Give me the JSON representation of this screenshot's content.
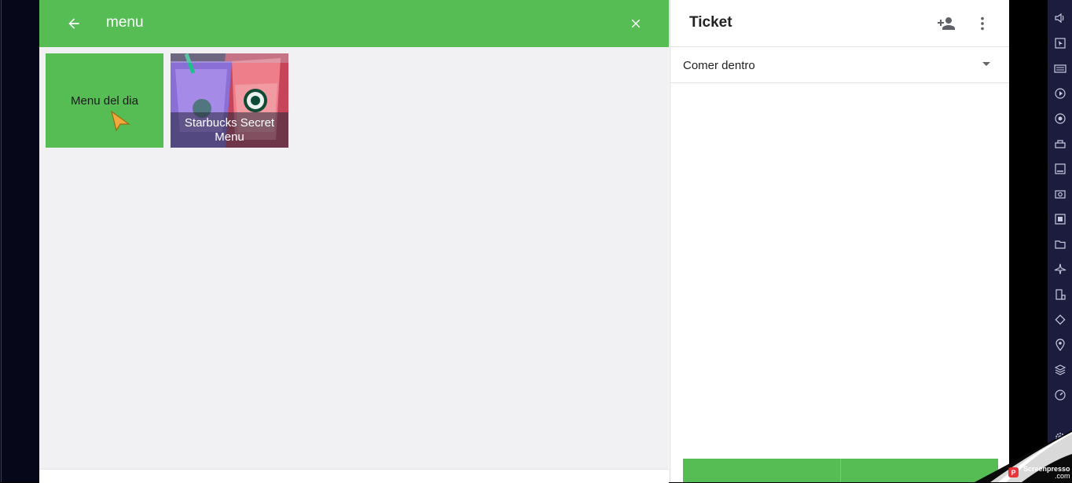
{
  "search": {
    "query": "menu"
  },
  "categories": [
    {
      "label": "Menu del dia"
    },
    {
      "label": "Starbucks Secret Menu"
    }
  ],
  "ticket": {
    "title": "Ticket",
    "dining_option": "Comer dentro"
  },
  "colors": {
    "accent": "#56bd55",
    "background": "#f1f0f3",
    "toolbar": "#1c1c3e"
  },
  "icons": {
    "back": "arrow-back-icon",
    "clear": "close-icon",
    "add_customer": "person-add-icon",
    "more": "more-vert-icon",
    "dropdown": "caret-down-icon"
  },
  "watermark": {
    "brand": "Screenpresso",
    "suffix": ".com",
    "logo_letter": "P"
  }
}
